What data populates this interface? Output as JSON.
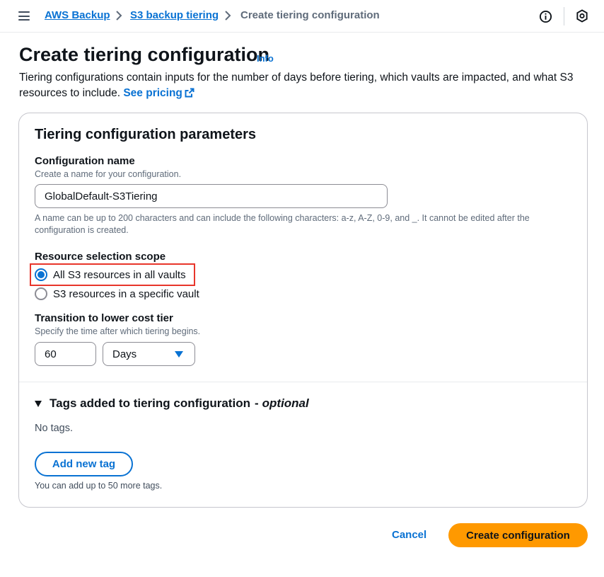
{
  "breadcrumb": {
    "items": [
      {
        "label": "AWS Backup"
      },
      {
        "label": "S3 backup tiering"
      },
      {
        "label": "Create tiering configuration"
      }
    ]
  },
  "icons": {
    "menu": "menu-icon",
    "info": "info-circle-icon",
    "feedback": "hexagon-icon",
    "external": "external-link-icon"
  },
  "header": {
    "title": "Create tiering configuration",
    "info_label": "Info",
    "description": "Tiering configurations contain inputs for the number of days before tiering, which vaults are impacted, and what S3 resources to include.",
    "pricing_link": "See pricing"
  },
  "params": {
    "section_title": "Tiering configuration parameters",
    "config_name": {
      "label": "Configuration name",
      "description": "Create a name for your configuration.",
      "value": "GlobalDefault-S3Tiering",
      "hint": "A name can be up to 200 characters and can include the following characters: a-z, A-Z, 0-9, and _. It cannot be edited after the configuration is created."
    },
    "scope": {
      "label": "Resource selection scope",
      "options": [
        {
          "label": "All S3 resources in all vaults",
          "checked": true
        },
        {
          "label": "S3 resources in a specific vault",
          "checked": false
        }
      ]
    },
    "transition": {
      "label": "Transition to lower cost tier",
      "description": "Specify the time after which tiering begins.",
      "value": "60",
      "unit": "Days"
    }
  },
  "tags": {
    "title": "Tags added to tiering configuration",
    "optional": "optional",
    "separator": "-",
    "empty": "No tags.",
    "add_button": "Add new tag",
    "hint": "You can add up to 50 more tags."
  },
  "footer": {
    "cancel": "Cancel",
    "create": "Create configuration"
  },
  "colors": {
    "link": "#0972d3",
    "primary": "#ff9900",
    "highlight": "#e8362b"
  }
}
